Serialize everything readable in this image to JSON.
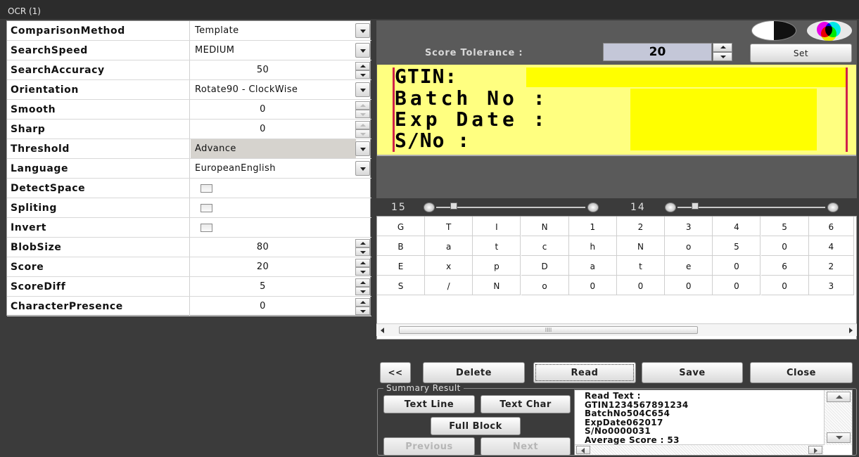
{
  "window": {
    "title": "OCR (1)"
  },
  "properties": [
    {
      "name": "ComparisonMethod",
      "value": "Template",
      "control": "dropdown"
    },
    {
      "name": "SearchSpeed",
      "value": "MEDIUM",
      "control": "dropdown"
    },
    {
      "name": "SearchAccuracy",
      "value": "50",
      "control": "spin"
    },
    {
      "name": "Orientation",
      "value": "Rotate90 - ClockWise",
      "control": "dropdown"
    },
    {
      "name": "Smooth",
      "value": "0",
      "control": "spin-disabled"
    },
    {
      "name": "Sharp",
      "value": "0",
      "control": "spin-disabled"
    },
    {
      "name": "Threshold",
      "value": "Advance",
      "control": "dropdown-gray"
    },
    {
      "name": "Language",
      "value": "EuropeanEnglish",
      "control": "dropdown"
    },
    {
      "name": "DetectSpace",
      "value": "",
      "control": "checkbox",
      "checked": false
    },
    {
      "name": "Spliting",
      "value": "",
      "control": "checkbox",
      "checked": false
    },
    {
      "name": "Invert",
      "value": "",
      "control": "checkbox",
      "checked": false
    },
    {
      "name": "BlobSize",
      "value": "80",
      "control": "spin"
    },
    {
      "name": "Score",
      "value": "20",
      "control": "spin"
    },
    {
      "name": "ScoreDiff",
      "value": "5",
      "control": "spin"
    },
    {
      "name": "CharacterPresence",
      "value": "0",
      "control": "spin"
    }
  ],
  "score_tolerance": {
    "label": "Score Tolerance :",
    "value": "20",
    "set_label": "Set"
  },
  "ocr_image": {
    "lines": [
      "GTIN:",
      "Batch No :",
      "Exp Date :",
      "S/No :"
    ],
    "colors": {
      "background": "#ffff80",
      "highlight": "#ffff00",
      "border": "#d0204a"
    }
  },
  "sliders": [
    {
      "value": "15",
      "level": 0.1
    },
    {
      "value": "14",
      "level": 0.1
    }
  ],
  "char_grid": [
    [
      "G",
      "T",
      "I",
      "N",
      "1",
      "2",
      "3",
      "4",
      "5",
      "6"
    ],
    [
      "B",
      "a",
      "t",
      "c",
      "h",
      "N",
      "o",
      "5",
      "0",
      "4"
    ],
    [
      "E",
      "x",
      "p",
      "D",
      "a",
      "t",
      "e",
      "0",
      "6",
      "2"
    ],
    [
      "S",
      "/",
      "N",
      "o",
      "0",
      "0",
      "0",
      "0",
      "0",
      "3"
    ]
  ],
  "grid_scroll_grip": "IIII",
  "buttons": {
    "back": "<<",
    "delete": "Delete",
    "read": "Read",
    "save": "Save",
    "close": "Close"
  },
  "summary": {
    "title": "Summary Result",
    "text_line": "Text Line",
    "text_char": "Text Char",
    "full_block": "Full Block",
    "previous": "Previous",
    "next": "Next",
    "result_lines": [
      "Read Text :",
      "GTIN1234567891234",
      "BatchNo504C654",
      "ExpDate062017",
      "S/No0000031",
      "Average Score : 53"
    ]
  }
}
